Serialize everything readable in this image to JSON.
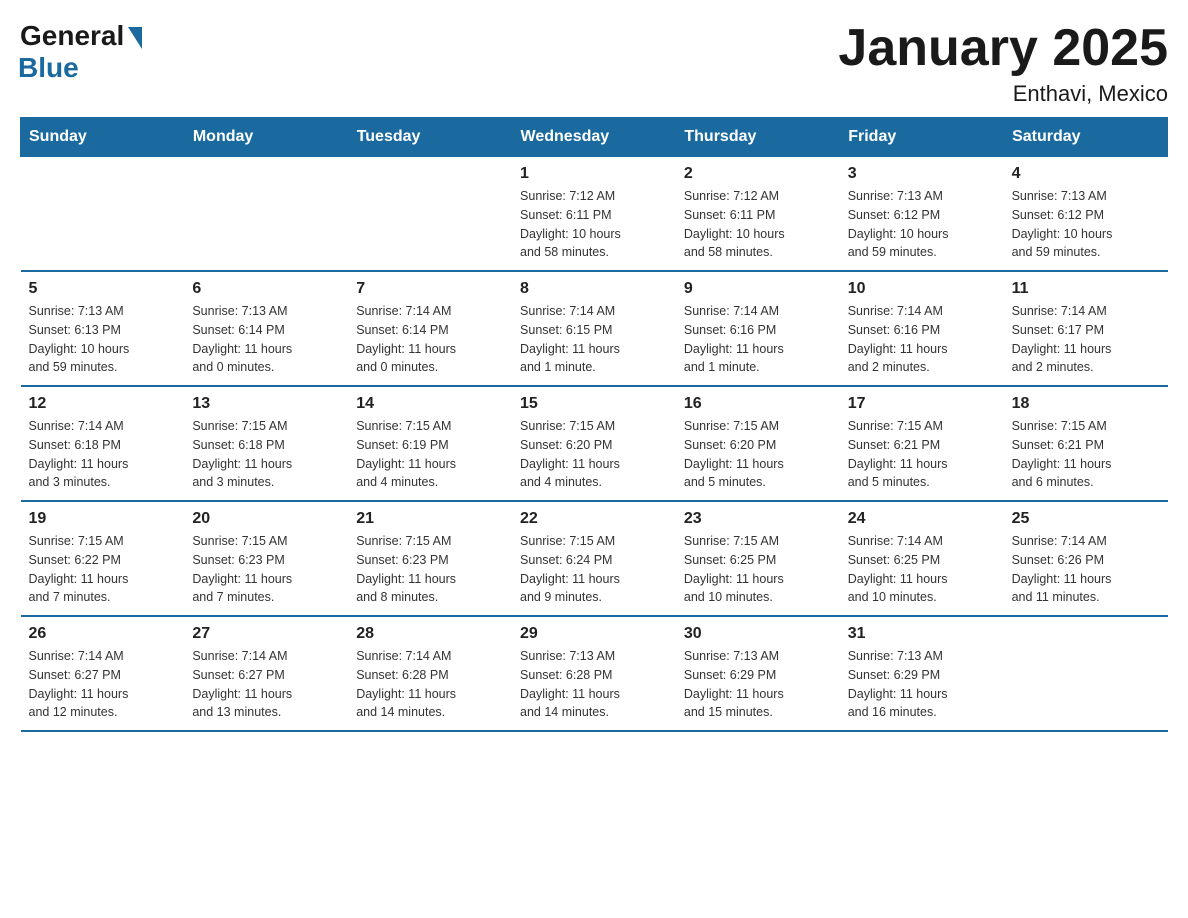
{
  "logo": {
    "general": "General",
    "blue": "Blue"
  },
  "title": "January 2025",
  "location": "Enthavi, Mexico",
  "days_header": [
    "Sunday",
    "Monday",
    "Tuesday",
    "Wednesday",
    "Thursday",
    "Friday",
    "Saturday"
  ],
  "weeks": [
    [
      {
        "day": "",
        "info": ""
      },
      {
        "day": "",
        "info": ""
      },
      {
        "day": "",
        "info": ""
      },
      {
        "day": "1",
        "info": "Sunrise: 7:12 AM\nSunset: 6:11 PM\nDaylight: 10 hours\nand 58 minutes."
      },
      {
        "day": "2",
        "info": "Sunrise: 7:12 AM\nSunset: 6:11 PM\nDaylight: 10 hours\nand 58 minutes."
      },
      {
        "day": "3",
        "info": "Sunrise: 7:13 AM\nSunset: 6:12 PM\nDaylight: 10 hours\nand 59 minutes."
      },
      {
        "day": "4",
        "info": "Sunrise: 7:13 AM\nSunset: 6:12 PM\nDaylight: 10 hours\nand 59 minutes."
      }
    ],
    [
      {
        "day": "5",
        "info": "Sunrise: 7:13 AM\nSunset: 6:13 PM\nDaylight: 10 hours\nand 59 minutes."
      },
      {
        "day": "6",
        "info": "Sunrise: 7:13 AM\nSunset: 6:14 PM\nDaylight: 11 hours\nand 0 minutes."
      },
      {
        "day": "7",
        "info": "Sunrise: 7:14 AM\nSunset: 6:14 PM\nDaylight: 11 hours\nand 0 minutes."
      },
      {
        "day": "8",
        "info": "Sunrise: 7:14 AM\nSunset: 6:15 PM\nDaylight: 11 hours\nand 1 minute."
      },
      {
        "day": "9",
        "info": "Sunrise: 7:14 AM\nSunset: 6:16 PM\nDaylight: 11 hours\nand 1 minute."
      },
      {
        "day": "10",
        "info": "Sunrise: 7:14 AM\nSunset: 6:16 PM\nDaylight: 11 hours\nand 2 minutes."
      },
      {
        "day": "11",
        "info": "Sunrise: 7:14 AM\nSunset: 6:17 PM\nDaylight: 11 hours\nand 2 minutes."
      }
    ],
    [
      {
        "day": "12",
        "info": "Sunrise: 7:14 AM\nSunset: 6:18 PM\nDaylight: 11 hours\nand 3 minutes."
      },
      {
        "day": "13",
        "info": "Sunrise: 7:15 AM\nSunset: 6:18 PM\nDaylight: 11 hours\nand 3 minutes."
      },
      {
        "day": "14",
        "info": "Sunrise: 7:15 AM\nSunset: 6:19 PM\nDaylight: 11 hours\nand 4 minutes."
      },
      {
        "day": "15",
        "info": "Sunrise: 7:15 AM\nSunset: 6:20 PM\nDaylight: 11 hours\nand 4 minutes."
      },
      {
        "day": "16",
        "info": "Sunrise: 7:15 AM\nSunset: 6:20 PM\nDaylight: 11 hours\nand 5 minutes."
      },
      {
        "day": "17",
        "info": "Sunrise: 7:15 AM\nSunset: 6:21 PM\nDaylight: 11 hours\nand 5 minutes."
      },
      {
        "day": "18",
        "info": "Sunrise: 7:15 AM\nSunset: 6:21 PM\nDaylight: 11 hours\nand 6 minutes."
      }
    ],
    [
      {
        "day": "19",
        "info": "Sunrise: 7:15 AM\nSunset: 6:22 PM\nDaylight: 11 hours\nand 7 minutes."
      },
      {
        "day": "20",
        "info": "Sunrise: 7:15 AM\nSunset: 6:23 PM\nDaylight: 11 hours\nand 7 minutes."
      },
      {
        "day": "21",
        "info": "Sunrise: 7:15 AM\nSunset: 6:23 PM\nDaylight: 11 hours\nand 8 minutes."
      },
      {
        "day": "22",
        "info": "Sunrise: 7:15 AM\nSunset: 6:24 PM\nDaylight: 11 hours\nand 9 minutes."
      },
      {
        "day": "23",
        "info": "Sunrise: 7:15 AM\nSunset: 6:25 PM\nDaylight: 11 hours\nand 10 minutes."
      },
      {
        "day": "24",
        "info": "Sunrise: 7:14 AM\nSunset: 6:25 PM\nDaylight: 11 hours\nand 10 minutes."
      },
      {
        "day": "25",
        "info": "Sunrise: 7:14 AM\nSunset: 6:26 PM\nDaylight: 11 hours\nand 11 minutes."
      }
    ],
    [
      {
        "day": "26",
        "info": "Sunrise: 7:14 AM\nSunset: 6:27 PM\nDaylight: 11 hours\nand 12 minutes."
      },
      {
        "day": "27",
        "info": "Sunrise: 7:14 AM\nSunset: 6:27 PM\nDaylight: 11 hours\nand 13 minutes."
      },
      {
        "day": "28",
        "info": "Sunrise: 7:14 AM\nSunset: 6:28 PM\nDaylight: 11 hours\nand 14 minutes."
      },
      {
        "day": "29",
        "info": "Sunrise: 7:13 AM\nSunset: 6:28 PM\nDaylight: 11 hours\nand 14 minutes."
      },
      {
        "day": "30",
        "info": "Sunrise: 7:13 AM\nSunset: 6:29 PM\nDaylight: 11 hours\nand 15 minutes."
      },
      {
        "day": "31",
        "info": "Sunrise: 7:13 AM\nSunset: 6:29 PM\nDaylight: 11 hours\nand 16 minutes."
      },
      {
        "day": "",
        "info": ""
      }
    ]
  ]
}
